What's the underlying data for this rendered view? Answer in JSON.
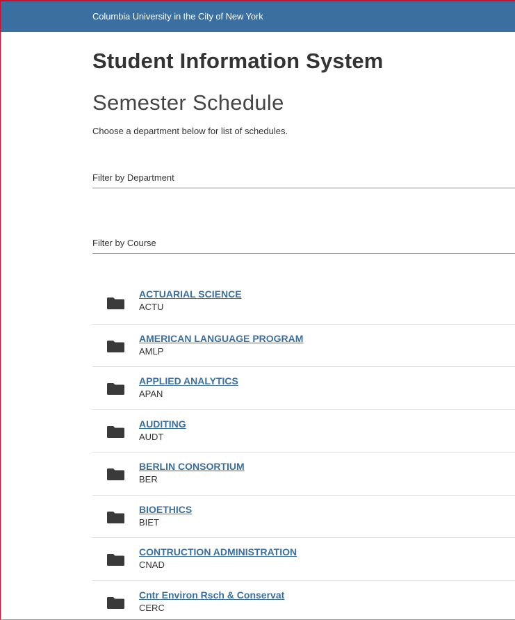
{
  "header": {
    "university": "Columbia University in the City of New York",
    "system_title": "Student Information System",
    "page_title": "Semester Schedule",
    "description": "Choose a department below for list of schedules."
  },
  "filters": {
    "department_placeholder": "Filter by Department",
    "course_placeholder": "Filter by Course"
  },
  "departments": [
    {
      "name": "ACTUARIAL SCIENCE",
      "code": "ACTU"
    },
    {
      "name": "AMERICAN LANGUAGE PROGRAM",
      "code": "AMLP"
    },
    {
      "name": "APPLIED ANALYTICS",
      "code": "APAN"
    },
    {
      "name": "AUDITING",
      "code": "AUDT"
    },
    {
      "name": "BERLIN CONSORTIUM",
      "code": "BER"
    },
    {
      "name": "BIOETHICS",
      "code": "BIET"
    },
    {
      "name": "CONTRUCTION ADMINISTRATION",
      "code": "CNAD"
    },
    {
      "name": "Cntr Environ Rsch & Conservat",
      "code": "CERC"
    }
  ],
  "icons": {
    "department": "folder-icon"
  },
  "colors": {
    "brand_blue": "#3a6f9f",
    "accent_red": "#c8102e",
    "folder": "#3a3a3a"
  }
}
